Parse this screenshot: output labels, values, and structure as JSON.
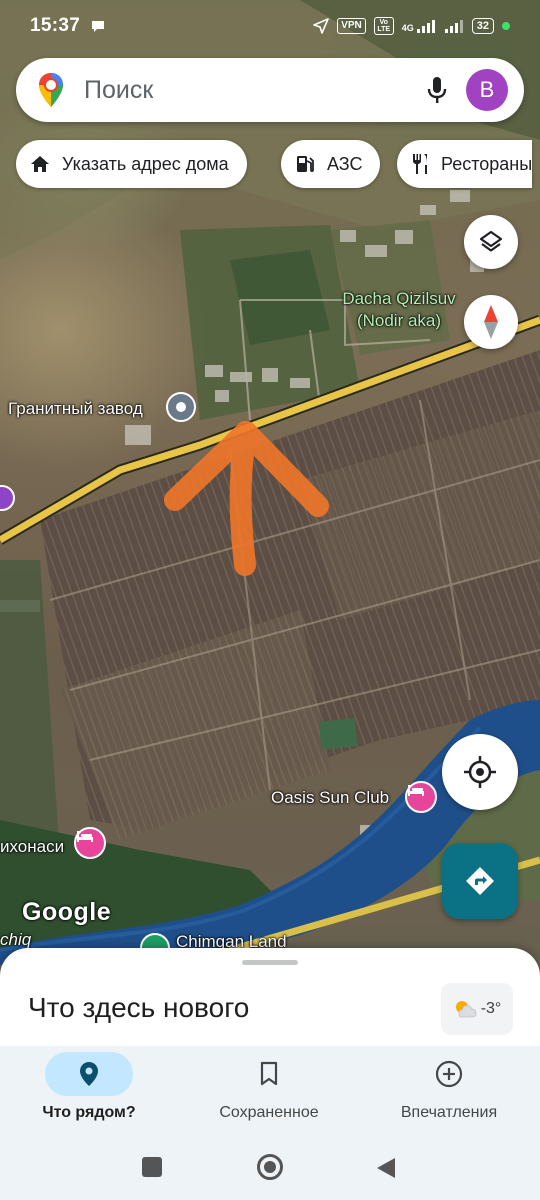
{
  "status_bar": {
    "time": "15:37",
    "vpn": "VPN",
    "volte": "Vo LTE",
    "network": "4G",
    "battery": "32"
  },
  "search": {
    "placeholder": "Поиск",
    "avatar_letter": "B"
  },
  "chips": [
    {
      "label": "Указать адрес дома",
      "icon": "home-icon"
    },
    {
      "label": "АЗС",
      "icon": "gas-station-icon"
    },
    {
      "label": "Рестораны",
      "icon": "restaurant-icon"
    }
  ],
  "map": {
    "labels": {
      "dacha": "Dacha Qizilsuv (Nodir aka)",
      "granite": "Гранитный завод",
      "oasis": "Oasis Sun Club",
      "uxonasi": "ихонаси",
      "chimgan": "Chimgan Land",
      "chiq": "chiq"
    },
    "google_logo": "Google",
    "colors": {
      "road": "#e8c547",
      "river": "#1f4f8a",
      "arrow": "#f0762a",
      "hotel_pin": "#e8449a"
    }
  },
  "bottom_sheet": {
    "title": "Что здесь нового",
    "weather_temp": "-3°"
  },
  "nav": {
    "items": [
      {
        "label": "Что рядом?",
        "icon": "location-pin-icon",
        "active": true
      },
      {
        "label": "Сохраненное",
        "icon": "bookmark-icon",
        "active": false
      },
      {
        "label": "Впечатления",
        "icon": "add-circle-icon",
        "active": false
      }
    ]
  }
}
